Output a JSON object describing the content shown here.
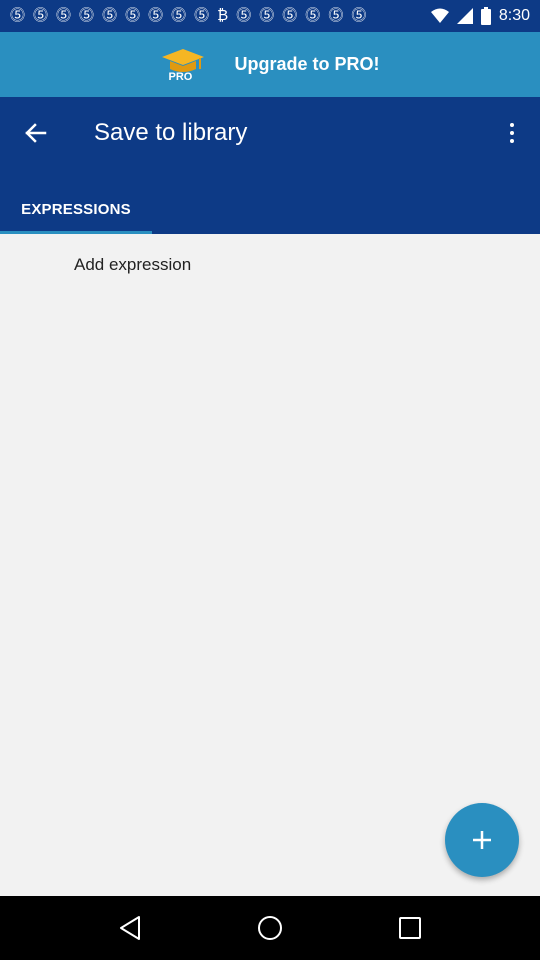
{
  "status_bar": {
    "time": "8:30",
    "notification_icons": [
      "pinterest-icon",
      "pinterest-icon",
      "pinterest-icon",
      "pinterest-icon",
      "pinterest-icon",
      "pinterest-icon",
      "pinterest-icon",
      "pinterest-icon",
      "pinterest-icon",
      "bitcoin-icon",
      "pinterest-icon",
      "pinterest-icon",
      "pinterest-icon",
      "pinterest-icon",
      "pinterest-icon",
      "pinterest-icon"
    ],
    "wifi_icon": "wifi-icon",
    "signal_icon": "signal-icon",
    "battery_icon": "battery-icon"
  },
  "promo": {
    "logo_text": "PRO",
    "title": "Upgrade to PRO!"
  },
  "app_bar": {
    "title": "Save to library",
    "back_icon": "back-arrow-icon",
    "overflow_icon": "more-vert-icon"
  },
  "tabs": [
    {
      "label": "EXPRESSIONS",
      "selected": true
    }
  ],
  "list": {
    "items": [
      {
        "label": "Add expression"
      }
    ]
  },
  "fab": {
    "icon": "plus-icon"
  },
  "nav_bar": {
    "back_icon": "nav-back-icon",
    "home_icon": "nav-home-icon",
    "recents_icon": "nav-recents-icon"
  },
  "colors": {
    "primary_dark": "#0d3a86",
    "accent": "#2a8fc0",
    "background": "#f2f2f2",
    "promo_hat": "#f5b623"
  }
}
